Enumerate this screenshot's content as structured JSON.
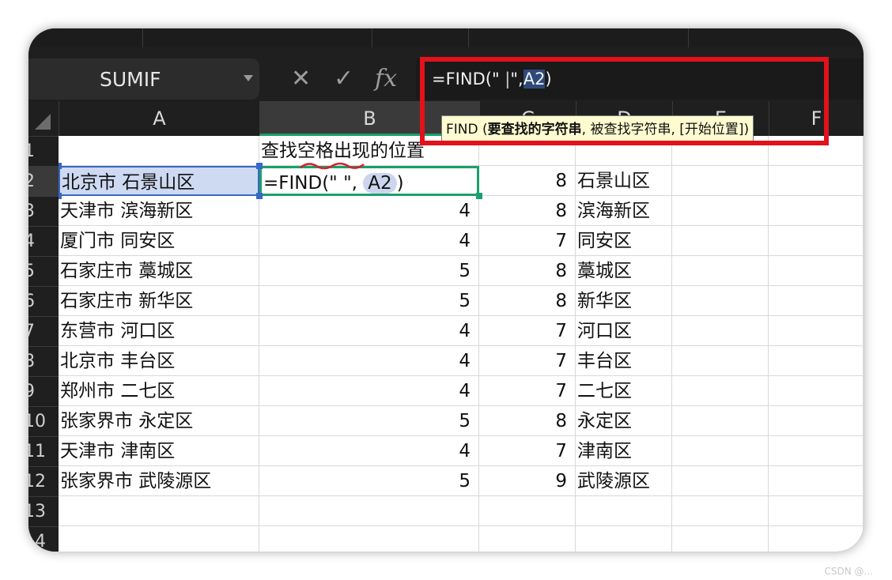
{
  "name_box": {
    "value": "SUMIF"
  },
  "formula_bar": {
    "cancel_symbol": "✕",
    "confirm_symbol": "✓",
    "fx_symbol": "fx",
    "formula_prefix": "=FIND(\" ",
    "formula_caret": "|",
    "formula_mid": "\",",
    "formula_ref": "A2",
    "formula_suffix": ")"
  },
  "columns": [
    "A",
    "B",
    "C",
    "D",
    "E",
    "F"
  ],
  "rows": [
    "1",
    "2",
    "3",
    "4",
    "5",
    "6",
    "7",
    "8",
    "9",
    "10",
    "11",
    "12",
    "13",
    "14"
  ],
  "header_B1": "查找空格出现的位置",
  "edit_cell": {
    "prefix": "=FIND(\" \",",
    "ref": "A2",
    "suffix": ")"
  },
  "table": [
    {
      "a": "北京市 石景山区",
      "b": "",
      "c": "8",
      "d": "石景山区"
    },
    {
      "a": "天津市 滨海新区",
      "b": "4",
      "c": "8",
      "d": "滨海新区"
    },
    {
      "a": "厦门市 同安区",
      "b": "4",
      "c": "7",
      "d": "同安区"
    },
    {
      "a": "石家庄市 藁城区",
      "b": "5",
      "c": "8",
      "d": "藁城区"
    },
    {
      "a": "石家庄市 新华区",
      "b": "5",
      "c": "8",
      "d": "新华区"
    },
    {
      "a": "东营市 河口区",
      "b": "4",
      "c": "7",
      "d": "河口区"
    },
    {
      "a": "北京市 丰台区",
      "b": "4",
      "c": "7",
      "d": "丰台区"
    },
    {
      "a": "郑州市 二七区",
      "b": "4",
      "c": "7",
      "d": "二七区"
    },
    {
      "a": "张家界市 永定区",
      "b": "5",
      "c": "8",
      "d": "永定区"
    },
    {
      "a": "天津市 津南区",
      "b": "4",
      "c": "7",
      "d": "津南区"
    },
    {
      "a": "张家界市 武陵源区",
      "b": "5",
      "c": "9",
      "d": "武陵源区"
    }
  ],
  "tooltip": {
    "func": "FIND (",
    "arg1": "要查找的字符串",
    "rest": ", 被查找字符串, [开始位置])"
  },
  "watermark": "CSDN @..."
}
